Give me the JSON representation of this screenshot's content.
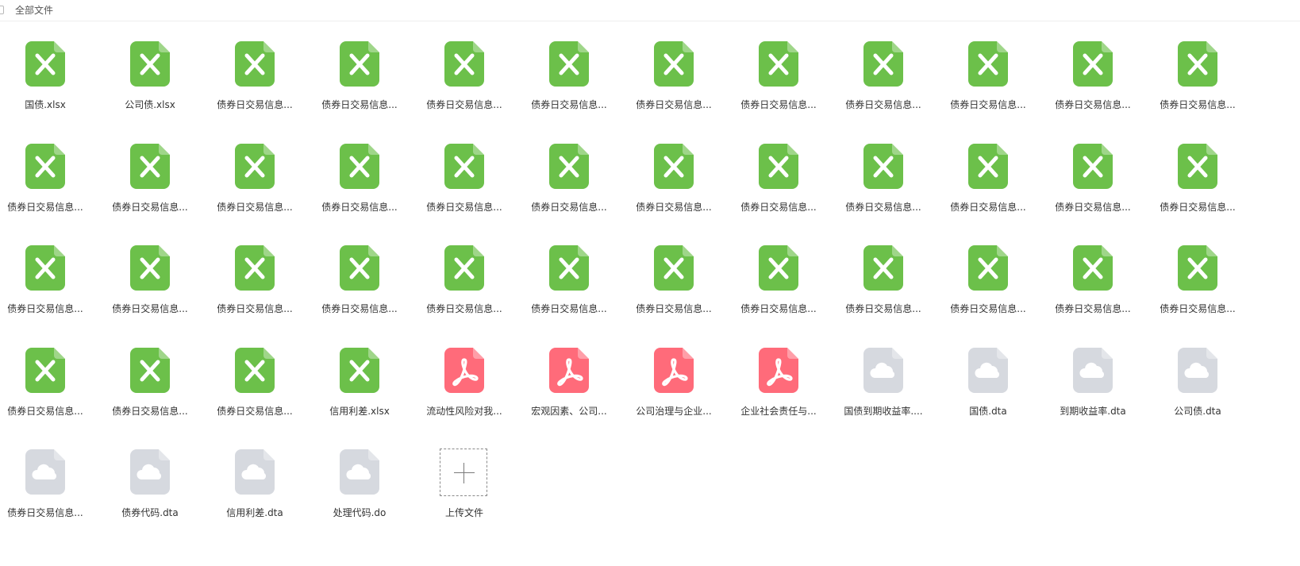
{
  "header": {
    "breadcrumb": "全部文件"
  },
  "colors": {
    "excel": "#6cc04a",
    "pdf": "#ff6b7a",
    "cloud": "#d6d9df"
  },
  "files": [
    {
      "name": "国债.xlsx",
      "type": "excel"
    },
    {
      "name": "公司债.xlsx",
      "type": "excel"
    },
    {
      "name": "债券日交易信息...",
      "type": "excel"
    },
    {
      "name": "债券日交易信息...",
      "type": "excel"
    },
    {
      "name": "债券日交易信息...",
      "type": "excel"
    },
    {
      "name": "债券日交易信息...",
      "type": "excel"
    },
    {
      "name": "债券日交易信息...",
      "type": "excel"
    },
    {
      "name": "债券日交易信息...",
      "type": "excel"
    },
    {
      "name": "债券日交易信息...",
      "type": "excel"
    },
    {
      "name": "债券日交易信息...",
      "type": "excel"
    },
    {
      "name": "债券日交易信息...",
      "type": "excel"
    },
    {
      "name": "债券日交易信息...",
      "type": "excel"
    },
    {
      "name": "债券日交易信息...",
      "type": "excel"
    },
    {
      "name": "债券日交易信息...",
      "type": "excel"
    },
    {
      "name": "债券日交易信息...",
      "type": "excel"
    },
    {
      "name": "债券日交易信息...",
      "type": "excel"
    },
    {
      "name": "债券日交易信息...",
      "type": "excel"
    },
    {
      "name": "债券日交易信息...",
      "type": "excel"
    },
    {
      "name": "债券日交易信息...",
      "type": "excel"
    },
    {
      "name": "债券日交易信息...",
      "type": "excel"
    },
    {
      "name": "债券日交易信息...",
      "type": "excel"
    },
    {
      "name": "债券日交易信息...",
      "type": "excel"
    },
    {
      "name": "债券日交易信息...",
      "type": "excel"
    },
    {
      "name": "债券日交易信息...",
      "type": "excel"
    },
    {
      "name": "债券日交易信息...",
      "type": "excel"
    },
    {
      "name": "债券日交易信息...",
      "type": "excel"
    },
    {
      "name": "债券日交易信息...",
      "type": "excel"
    },
    {
      "name": "债券日交易信息...",
      "type": "excel"
    },
    {
      "name": "债券日交易信息...",
      "type": "excel"
    },
    {
      "name": "债券日交易信息...",
      "type": "excel"
    },
    {
      "name": "债券日交易信息...",
      "type": "excel"
    },
    {
      "name": "债券日交易信息...",
      "type": "excel"
    },
    {
      "name": "债券日交易信息...",
      "type": "excel"
    },
    {
      "name": "债券日交易信息...",
      "type": "excel"
    },
    {
      "name": "债券日交易信息...",
      "type": "excel"
    },
    {
      "name": "债券日交易信息...",
      "type": "excel"
    },
    {
      "name": "债券日交易信息...",
      "type": "excel"
    },
    {
      "name": "债券日交易信息...",
      "type": "excel"
    },
    {
      "name": "债券日交易信息...",
      "type": "excel"
    },
    {
      "name": "信用利差.xlsx",
      "type": "excel"
    },
    {
      "name": "流动性风险对我...",
      "type": "pdf"
    },
    {
      "name": "宏观因素、公司...",
      "type": "pdf"
    },
    {
      "name": "公司治理与企业...",
      "type": "pdf"
    },
    {
      "name": "企业社会责任与...",
      "type": "pdf"
    },
    {
      "name": "国债到期收益率....",
      "type": "cloud"
    },
    {
      "name": "国债.dta",
      "type": "cloud"
    },
    {
      "name": "到期收益率.dta",
      "type": "cloud"
    },
    {
      "name": "公司债.dta",
      "type": "cloud"
    },
    {
      "name": "债券日交易信息...",
      "type": "cloud"
    },
    {
      "name": "债券代码.dta",
      "type": "cloud"
    },
    {
      "name": "信用利差.dta",
      "type": "cloud"
    },
    {
      "name": "处理代码.do",
      "type": "cloud"
    }
  ],
  "upload": {
    "label": "上传文件"
  }
}
